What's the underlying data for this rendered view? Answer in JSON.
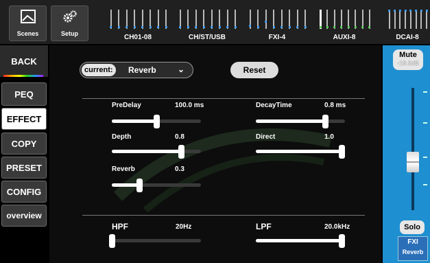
{
  "topbar": {
    "scenes_label": "Scenes",
    "setup_label": "Setup",
    "banks": [
      {
        "label": "CH01-08"
      },
      {
        "label": "CH/ST/USB"
      },
      {
        "label": "FXI-4"
      },
      {
        "label": "AUXI-8"
      },
      {
        "label": "DCAI-8"
      }
    ]
  },
  "sidebar": {
    "back": "BACK",
    "items": [
      {
        "label": "PEQ",
        "selected": false
      },
      {
        "label": "EFFECT",
        "selected": true
      },
      {
        "label": "COPY",
        "selected": false
      },
      {
        "label": "PRESET",
        "selected": false
      },
      {
        "label": "CONFIG",
        "selected": false
      },
      {
        "label": "overview",
        "selected": false
      }
    ]
  },
  "effect": {
    "current_label": "current:",
    "current_value": "Reverb",
    "reset_label": "Reset",
    "params": [
      {
        "name": "PreDelay",
        "value": "100.0 ms",
        "level": 0.5
      },
      {
        "name": "DecayTime",
        "value": "0.8 ms",
        "level": 0.8
      },
      {
        "name": "Depth",
        "value": "0.8",
        "level": 0.8
      },
      {
        "name": "Direct",
        "value": "1.0",
        "level": 1.0
      },
      {
        "name": "Reverb",
        "value": "0.3",
        "level": 0.3
      }
    ],
    "filters": [
      {
        "name": "HPF",
        "value": "20Hz",
        "level": 0.0
      },
      {
        "name": "LPF",
        "value": "20.0kHz",
        "level": 1.0
      }
    ]
  },
  "strip": {
    "mute_label": "Mute",
    "level": "-19.5dB",
    "fader_level": 0.37,
    "solo_label": "Solo",
    "fx_label": "FXI",
    "fx_name": "Reverb"
  },
  "colors": {
    "accent": "#1e8fd0",
    "dot_blue": "#3aa0ff",
    "dot_green": "#4fd04f"
  }
}
